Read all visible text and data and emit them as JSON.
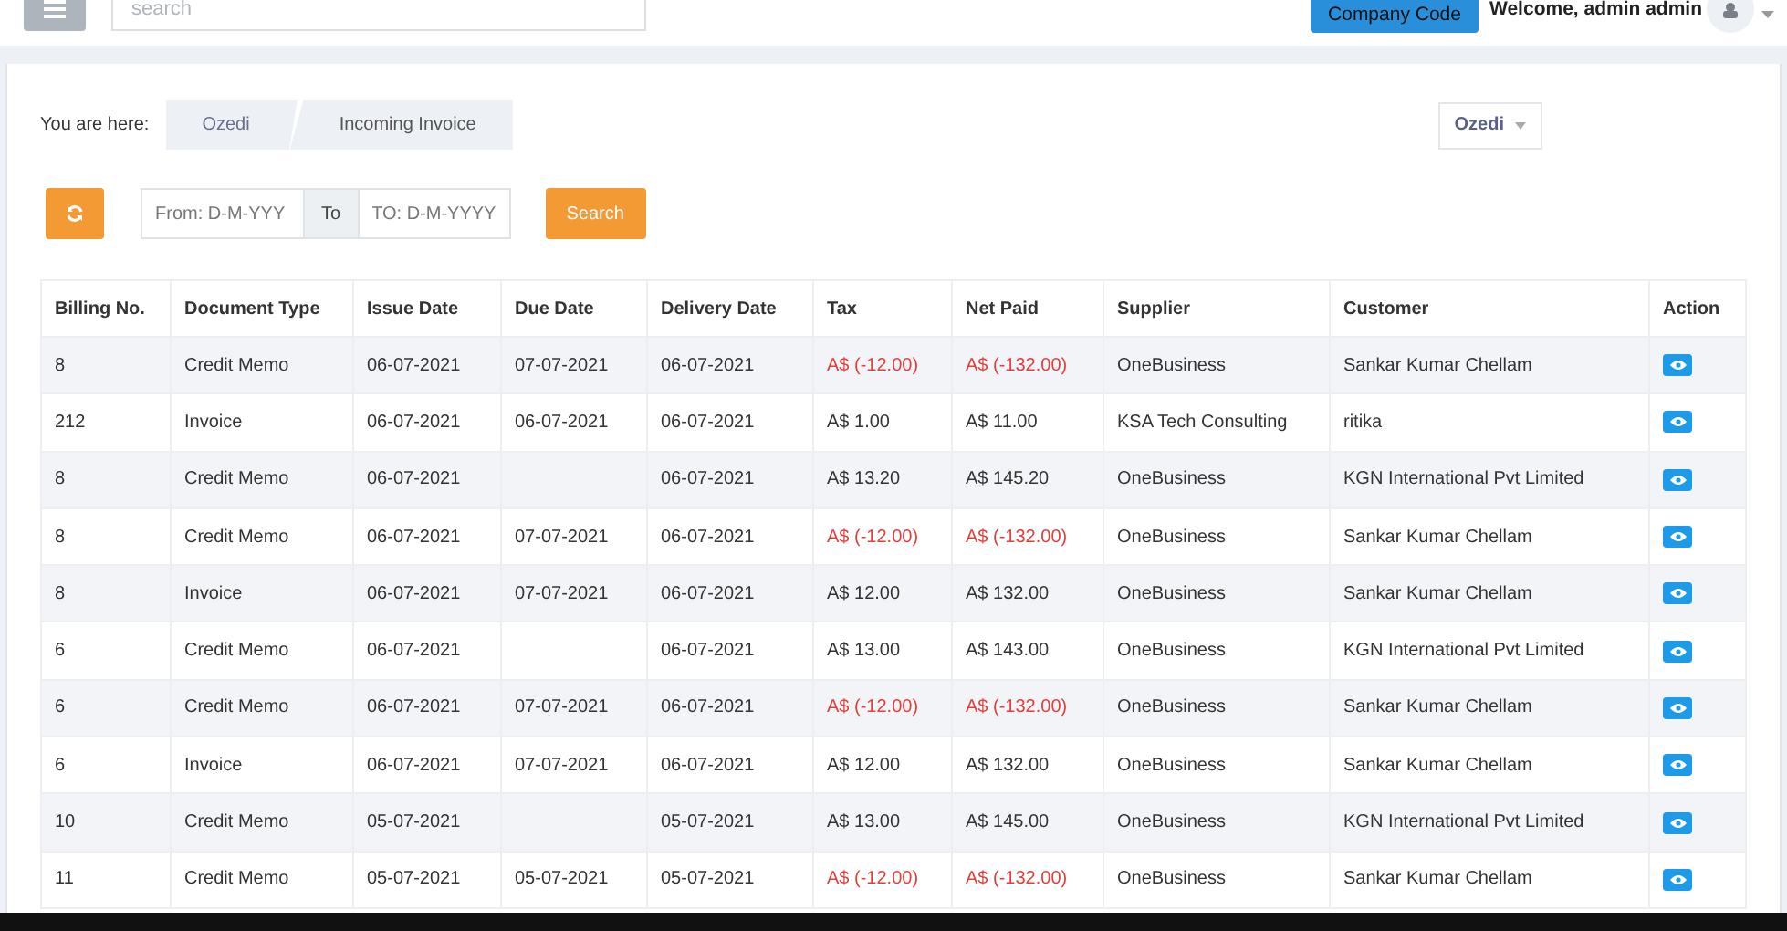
{
  "topbar": {
    "search": {
      "placeholder": "search"
    },
    "company_button": "Company Code",
    "welcome": "Welcome, admin admin"
  },
  "breadcrumb": {
    "label": "You are here:",
    "items": [
      "Ozedi",
      "Incoming Invoice"
    ]
  },
  "company_select": {
    "value": "Ozedi"
  },
  "filters": {
    "from": {
      "placeholder": "From: D-M-YYY"
    },
    "to_label": "To",
    "to": {
      "placeholder": "TO: D-M-YYYY"
    },
    "search_button": "Search"
  },
  "table": {
    "columns": [
      "Billing No.",
      "Document Type",
      "Issue Date",
      "Due Date",
      "Delivery Date",
      "Tax",
      "Net Paid",
      "Supplier",
      "Customer",
      "Action"
    ],
    "rows": [
      {
        "billing_no": "8",
        "document_type": "Credit Memo",
        "issue_date": "06-07-2021",
        "due_date": "07-07-2021",
        "delivery_date": "06-07-2021",
        "tax": "A$ (-12.00)",
        "net_paid": "A$ (-132.00)",
        "negative": true,
        "supplier": "OneBusiness",
        "customer": "Sankar Kumar Chellam"
      },
      {
        "billing_no": "212",
        "document_type": "Invoice",
        "issue_date": "06-07-2021",
        "due_date": "06-07-2021",
        "delivery_date": "06-07-2021",
        "tax": "A$ 1.00",
        "net_paid": "A$ 11.00",
        "negative": false,
        "supplier": "KSA Tech Consulting",
        "customer": "ritika"
      },
      {
        "billing_no": "8",
        "document_type": "Credit Memo",
        "issue_date": "06-07-2021",
        "delivery_date": "06-07-2021",
        "tax": "A$ 13.20",
        "net_paid": "A$ 145.20",
        "negative": false,
        "supplier": "OneBusiness",
        "customer": "KGN International Pvt Limited"
      },
      {
        "billing_no": "8",
        "document_type": "Credit Memo",
        "issue_date": "06-07-2021",
        "due_date": "07-07-2021",
        "delivery_date": "06-07-2021",
        "tax": "A$ (-12.00)",
        "net_paid": "A$ (-132.00)",
        "negative": true,
        "supplier": "OneBusiness",
        "customer": "Sankar Kumar Chellam"
      },
      {
        "billing_no": "8",
        "document_type": "Invoice",
        "issue_date": "06-07-2021",
        "due_date": "07-07-2021",
        "delivery_date": "06-07-2021",
        "tax": "A$ 12.00",
        "net_paid": "A$ 132.00",
        "negative": false,
        "supplier": "OneBusiness",
        "customer": "Sankar Kumar Chellam"
      },
      {
        "billing_no": "6",
        "document_type": "Credit Memo",
        "issue_date": "06-07-2021",
        "delivery_date": "06-07-2021",
        "tax": "A$ 13.00",
        "net_paid": "A$ 143.00",
        "negative": false,
        "supplier": "OneBusiness",
        "customer": "KGN International Pvt Limited"
      },
      {
        "billing_no": "6",
        "document_type": "Credit Memo",
        "issue_date": "06-07-2021",
        "due_date": "07-07-2021",
        "delivery_date": "06-07-2021",
        "tax": "A$ (-12.00)",
        "net_paid": "A$ (-132.00)",
        "negative": true,
        "supplier": "OneBusiness",
        "customer": "Sankar Kumar Chellam"
      },
      {
        "billing_no": "6",
        "document_type": "Invoice",
        "issue_date": "06-07-2021",
        "due_date": "07-07-2021",
        "delivery_date": "06-07-2021",
        "tax": "A$ 12.00",
        "net_paid": "A$ 132.00",
        "negative": false,
        "supplier": "OneBusiness",
        "customer": "Sankar Kumar Chellam"
      },
      {
        "billing_no": "10",
        "document_type": "Credit Memo",
        "issue_date": "05-07-2021",
        "delivery_date": "05-07-2021",
        "tax": "A$ 13.00",
        "net_paid": "A$ 145.00",
        "negative": false,
        "supplier": "OneBusiness",
        "customer": "KGN International Pvt Limited"
      },
      {
        "billing_no": "11",
        "document_type": "Credit Memo",
        "issue_date": "05-07-2021",
        "due_date": "05-07-2021",
        "delivery_date": "05-07-2021",
        "tax": "A$ (-12.00)",
        "net_paid": "A$ (-132.00)",
        "negative": true,
        "supplier": "OneBusiness",
        "customer": "Sankar Kumar Chellam"
      }
    ]
  }
}
